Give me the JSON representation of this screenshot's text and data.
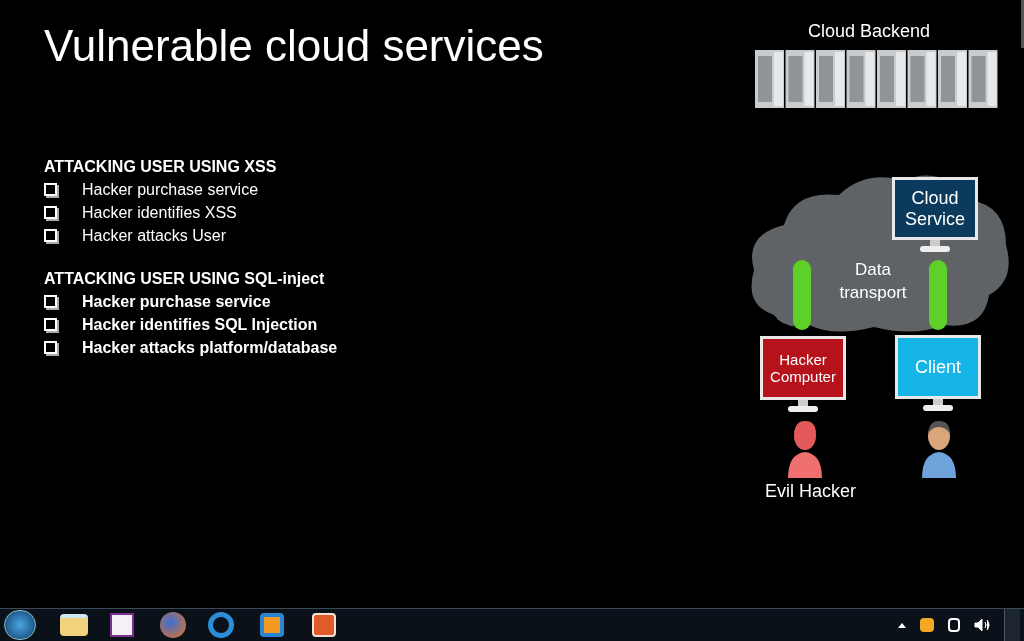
{
  "slide": {
    "title": "Vulnerable cloud services",
    "sections": [
      {
        "heading": "ATTACKING USER USING XSS",
        "bold_items": false,
        "items": [
          "Hacker purchase service",
          "Hacker identifies XSS",
          "Hacker attacks User"
        ]
      },
      {
        "heading": "ATTACKING USER USING SQL-inject",
        "bold_items": true,
        "items": [
          "Hacker purchase service",
          "Hacker identifies SQL Injection",
          "Hacker attacks platform/database"
        ]
      }
    ],
    "diagram": {
      "backend_label": "Cloud Backend",
      "cloud_label": "Data transport",
      "monitors": [
        {
          "label": "Cloud Service",
          "color": "#0b3a5c"
        },
        {
          "label": "Hacker Computer",
          "color": "#b5121b"
        },
        {
          "label": "Client",
          "color": "#14b4e6"
        }
      ],
      "people": [
        {
          "kind": "hacker",
          "label": "Evil Hacker"
        },
        {
          "kind": "user"
        }
      ]
    }
  }
}
